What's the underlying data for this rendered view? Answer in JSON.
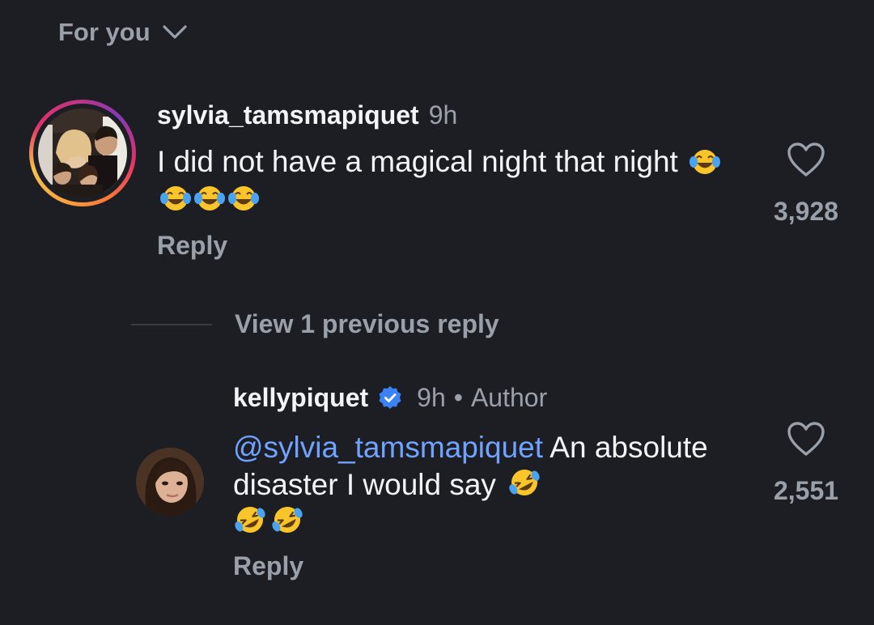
{
  "feed": {
    "sort_label": "For you"
  },
  "comments": [
    {
      "username": "sylvia_tamsmapiquet",
      "time": "9h",
      "text": "I did not have a magical night that night",
      "emoji_count": 4,
      "emoji": "face-with-tears-of-joy",
      "reply_label": "Reply",
      "like_count": "3,928"
    }
  ],
  "view_replies_label": "View 1 previous reply",
  "replies": [
    {
      "username": "kellypiquet",
      "verified": true,
      "time": "9h",
      "separator": "•",
      "author_label": "Author",
      "mention": "@sylvia_tamsmapiquet",
      "text": "An absolute disaster I would say",
      "emoji": "rolling-on-the-floor-laughing",
      "reply_label": "Reply",
      "like_count": "2,551"
    }
  ],
  "colors": {
    "background": "#1d1e23",
    "primary_text": "#f3f4f6",
    "secondary_text": "#9aa0aa",
    "mention": "#70a3ff",
    "verified": "#3b82f6"
  }
}
